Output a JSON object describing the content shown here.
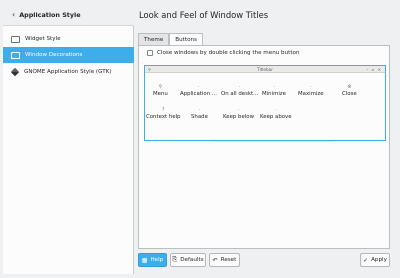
{
  "sidebar": {
    "back_icon": "chevron-left-icon",
    "title": "Application Style",
    "items": [
      {
        "label": "Widget Style",
        "icon": "window-icon"
      },
      {
        "label": "Window Decorations",
        "icon": "window-icon",
        "selected": true
      },
      {
        "label": "GNOME Application Style (GTK)",
        "icon": "gtk-icon"
      }
    ]
  },
  "main": {
    "title": "Look and Feel of Window Titles",
    "tabs": [
      {
        "label": "Theme",
        "active": false
      },
      {
        "label": "Buttons",
        "active": true
      }
    ],
    "checkbox_label": "Close windows by double clicking the menu button",
    "checkbox_checked": false,
    "preview": {
      "titlebar_label": "Titlebar",
      "buttons_row1": [
        {
          "label": "Menu",
          "glyph": "⚲"
        },
        {
          "label": "Application ...",
          "glyph": "·"
        },
        {
          "label": "On all deskt...",
          "glyph": "·"
        },
        {
          "label": "Minimize",
          "glyph": "·"
        },
        {
          "label": "Maximize",
          "glyph": "·"
        },
        {
          "label": "Close",
          "glyph": "⊗"
        }
      ],
      "buttons_row2": [
        {
          "label": "Context help",
          "glyph": "?"
        },
        {
          "label": "Shade",
          "glyph": "·"
        },
        {
          "label": "Keep below",
          "glyph": "·"
        },
        {
          "label": "Keep above",
          "glyph": "·"
        }
      ]
    }
  },
  "footer": {
    "help_label": "Help",
    "defaults_label": "Defaults",
    "reset_label": "Reset",
    "apply_label": "Apply"
  },
  "colors": {
    "accent": "#3daee9",
    "background": "#eff0f1",
    "panel": "#fcfcfc"
  }
}
